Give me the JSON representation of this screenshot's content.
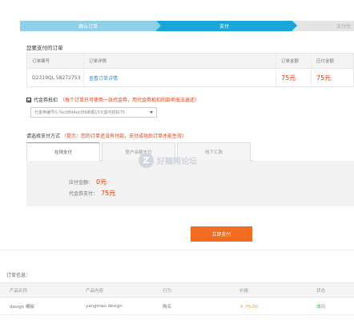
{
  "steps": [
    {
      "label": "确认订单"
    },
    {
      "label": "支付"
    },
    {
      "label": "支付完"
    }
  ],
  "order_section": {
    "title": "您要支付的订单",
    "headers": [
      "订单编号",
      "订单详情",
      "订单金额",
      "应付金额"
    ],
    "row": {
      "order_no": "D2319QL 58272753",
      "detail": "查看订单详情",
      "amount": "75元",
      "payable": "75元"
    }
  },
  "voucher": {
    "label": "代金券抵扣",
    "note": "（每个订单只可使用一张代金券，用代金券抵扣的款项无法退还）",
    "selected": "代金券编号0-7ec08d4ec0l9余额15元需可抵扣75"
  },
  "payment": {
    "label": "请选择支付方式",
    "note": "（提示：您的订单还没有付款，支付成功后订单才能生效）",
    "tabs": [
      "在线支付",
      "账户余额支付",
      "线下汇款"
    ],
    "payable_label": "应付金额：",
    "payable_value": "0元",
    "voucher_pay_label": "代金券支付：",
    "voucher_pay_value": "75元"
  },
  "watermark": {
    "icon": "Z",
    "text": "好赚网论坛"
  },
  "submit_label": "立即支付",
  "order_info": {
    "title": "订单信息：",
    "headers": [
      "产品名称",
      "产品内容",
      "行为",
      "价格",
      "状态"
    ],
    "row": {
      "name": "design 模板",
      "content": "yangmao design",
      "action": "购买",
      "price": "￥ 75.00",
      "status": "成功"
    }
  }
}
